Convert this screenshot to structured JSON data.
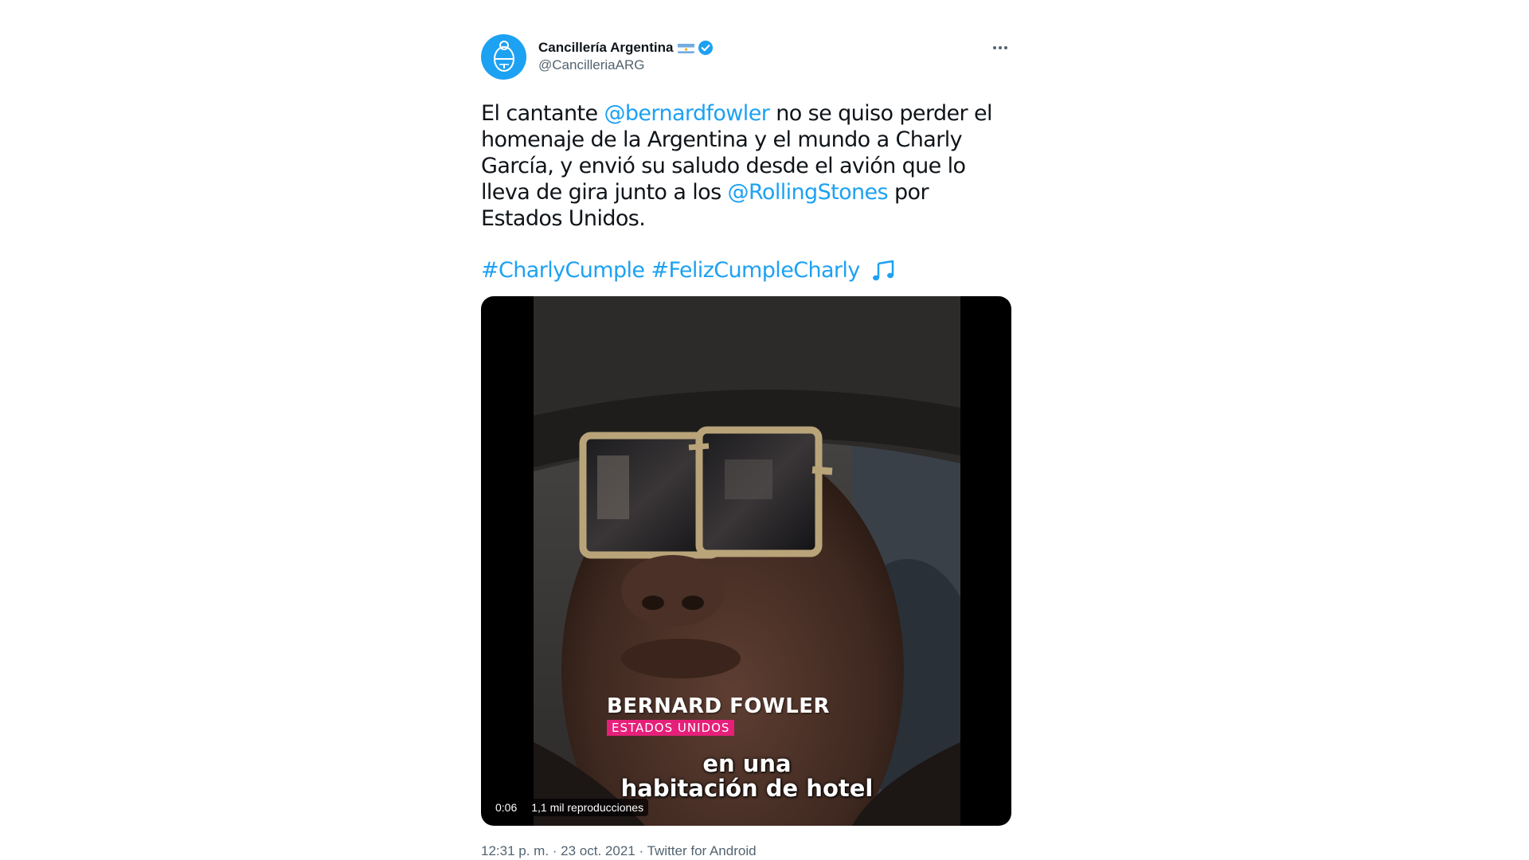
{
  "account": {
    "display_name": "Cancillería Argentina",
    "handle": "@CancilleriaARG",
    "verified": true,
    "avatar_icon": "argentina-coat-of-arms-icon",
    "flag_icon": "argentina-flag-icon"
  },
  "tweet": {
    "text_before_mention1": "El cantante ",
    "mention1": "@bernardfowler",
    "text_between": " no se quiso perder el homenaje de la Argentina y el mundo a Charly García, y envió su saludo desde el avión que lo lleva de gira junto a los ",
    "mention2": "@RollingStones",
    "text_after": " por Estados Unidos.",
    "hashtag1": "#CharlyCumple",
    "hashtag2": "#FelizCumpleCharly",
    "emoji_icon": "musical-notes-icon"
  },
  "video": {
    "lower_third_first": "BERNARD",
    "lower_third_last": "FOWLER",
    "lower_third_country": "ESTADOS UNIDOS",
    "subtitle_line1": "en una",
    "subtitle_line2": "habitación de hotel",
    "elapsed": "0:06",
    "views": "1,1 mil reproducciones"
  },
  "meta": {
    "time": "12:31 p. m.",
    "separator1": " · ",
    "date": "23 oct. 2021",
    "separator2": " · ",
    "source": "Twitter for Android"
  },
  "colors": {
    "link": "#1da1f2",
    "muted": "#536471",
    "lower_third_accent": "#e6207a"
  }
}
